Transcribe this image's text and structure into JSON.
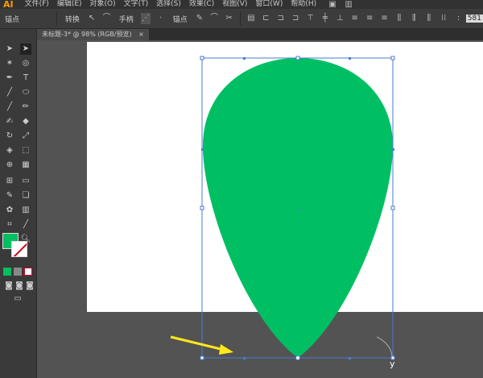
{
  "app": {
    "logo": "AI"
  },
  "menu": [
    "文件(F)",
    "编辑(E)",
    "对象(O)",
    "文字(T)",
    "选择(S)",
    "效果(C)",
    "视图(V)",
    "窗口(W)",
    "帮助(H)"
  ],
  "control_bar": {
    "anchor_label": "锚点",
    "convert_label": "转换",
    "handle_label": "手柄",
    "anchors_label": "锚点",
    "width_value": "581"
  },
  "document_tab": {
    "title": "未标题-3* @ 98% (RGB/预览)",
    "close": "×"
  },
  "colors": {
    "fill": "#00bf63",
    "arrow": "#ffe81a",
    "selection": "#4a7bd0"
  },
  "cursor_label": "y"
}
